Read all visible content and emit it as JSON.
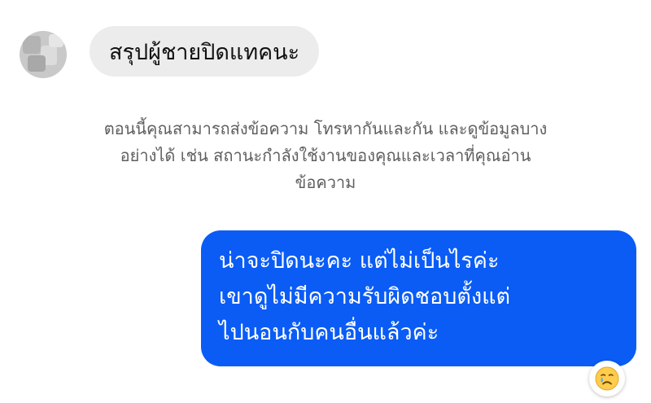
{
  "conversation": {
    "incoming_message": "สรุปผู้ชายปิดแทคนะ",
    "system_notice_lines": [
      "ตอนนี้คุณสามารถส่งข้อความ โทรหากันและกัน และดูข้อมูลบาง",
      "อย่างได้ เช่น สถานะกำลังใช้งานของคุณและเวลาที่คุณอ่าน",
      "ข้อความ"
    ],
    "outgoing_message_lines": [
      "น่าจะปิดนะคะ แต่ไม่เป็นไรค่ะ",
      "เขาดูไม่มีความรับผิดชอบตั้งแต่",
      "ไปนอนกับคนอื่นแล้วค่ะ"
    ],
    "reaction": "crying-face-emoji"
  },
  "colors": {
    "outgoing_bubble": "#0a5cf5",
    "incoming_bubble": "#ececec",
    "notice_text": "#5f5f5f",
    "background": "#ffffff"
  }
}
